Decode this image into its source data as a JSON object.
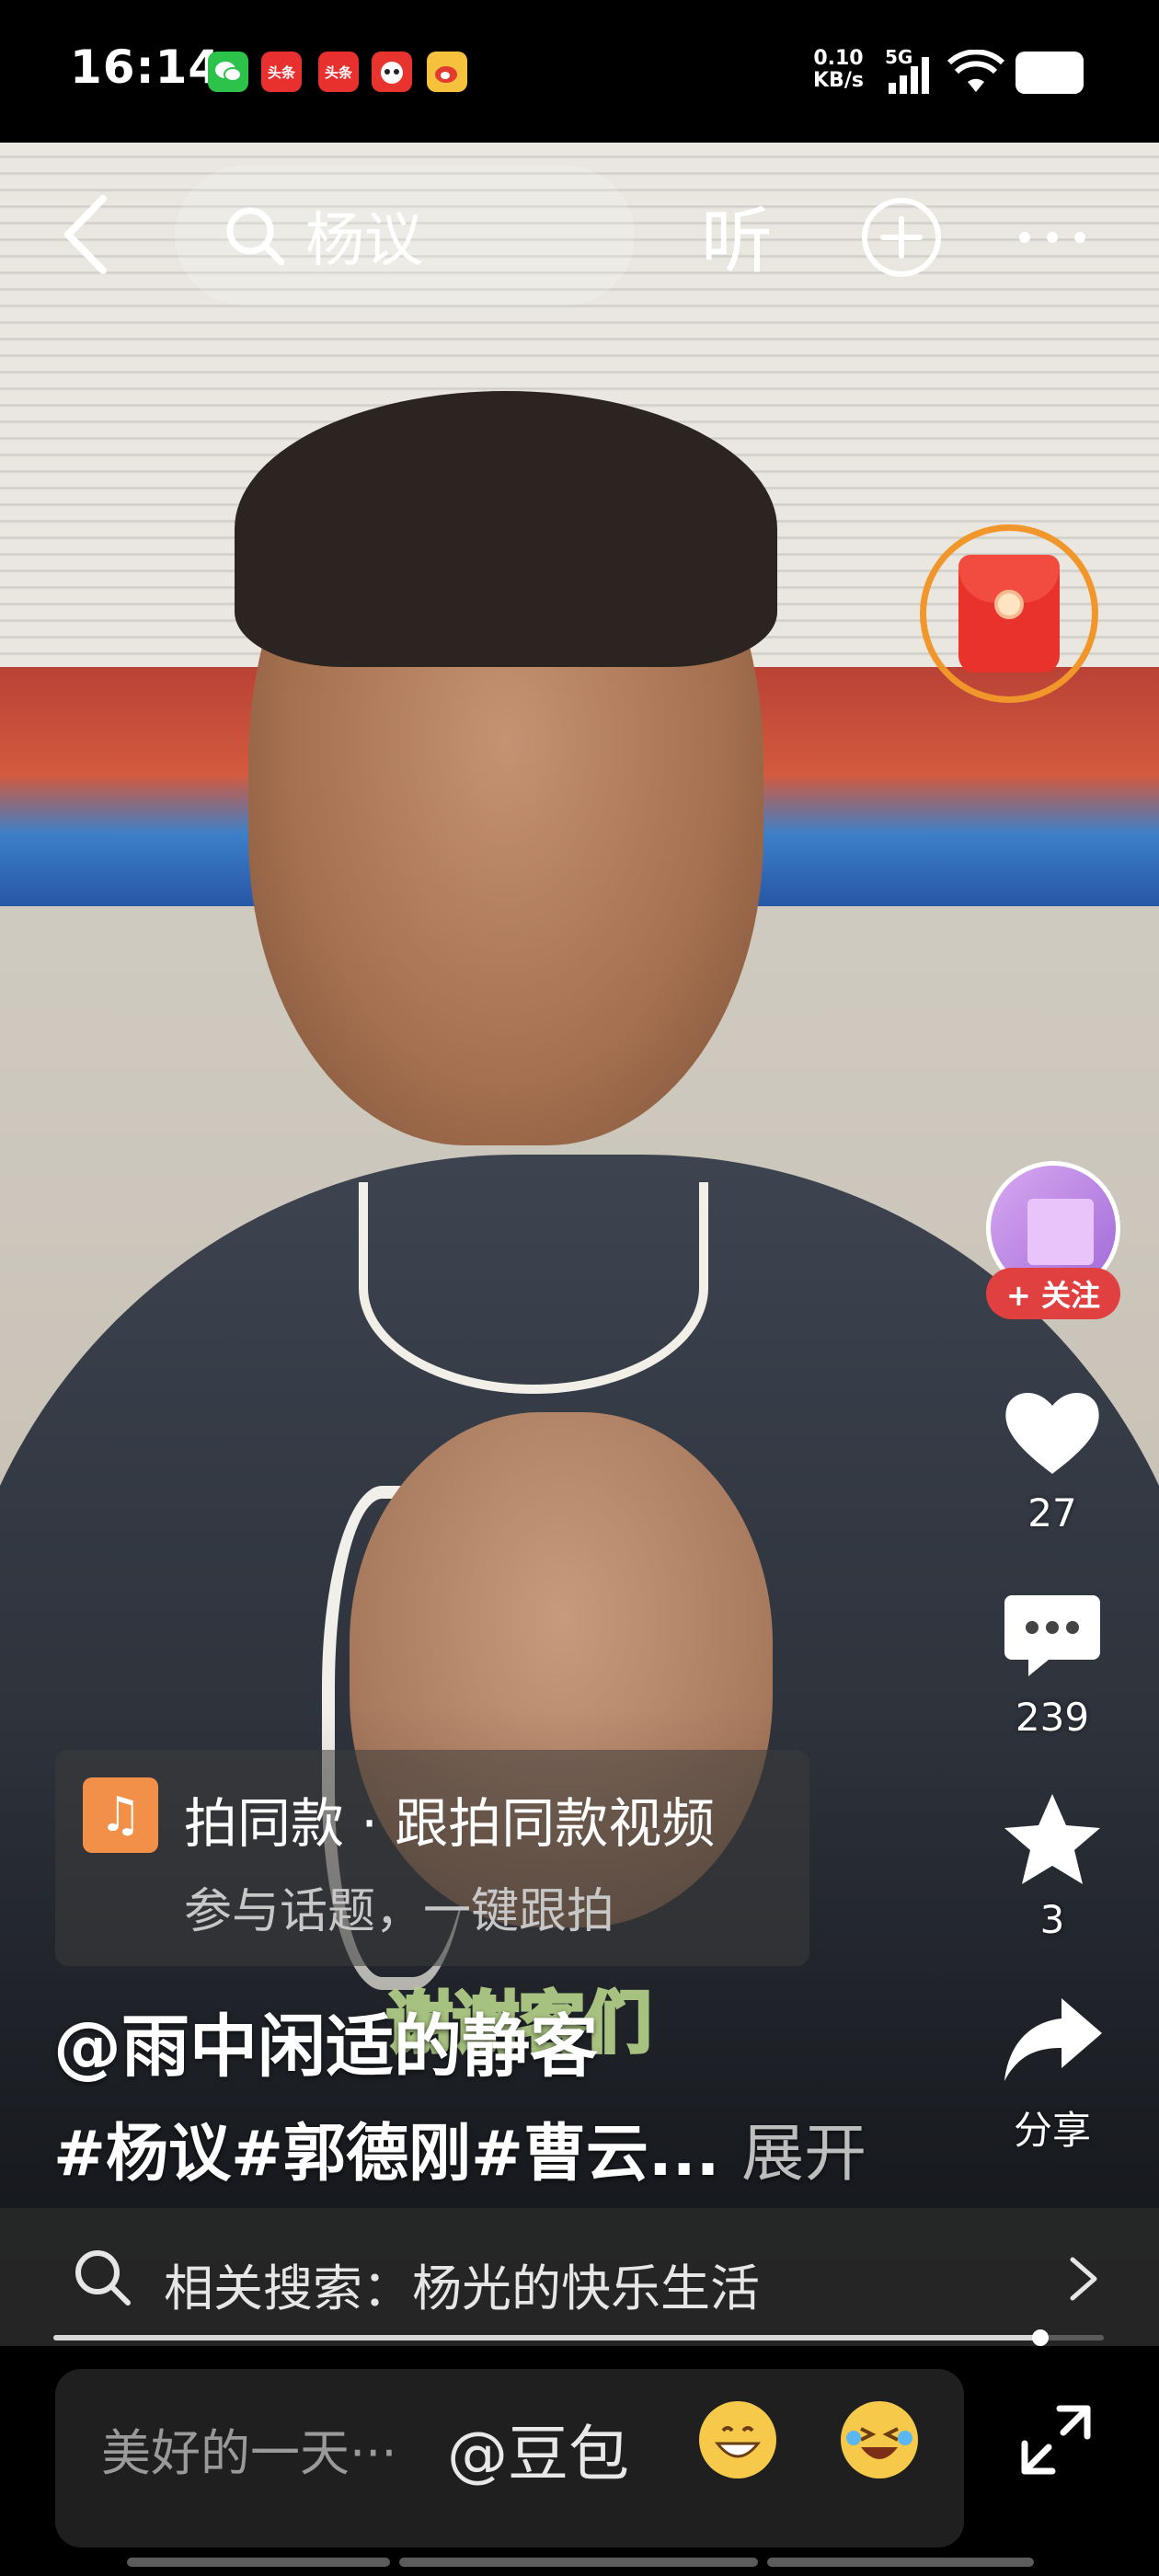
{
  "status_bar": {
    "time": "16:14",
    "app_icons": [
      "wechat-icon",
      "toutiao-icon",
      "toutiao-icon",
      "app-icon",
      "weibo-icon"
    ],
    "toutiao_label": "头条",
    "net_speed_value": "0.10",
    "net_speed_unit": "KB/s",
    "network": "5G"
  },
  "top_nav": {
    "search_query": "杨议",
    "listen_label": "听"
  },
  "right_actions": {
    "follow_label": "+ 关注",
    "likes": "27",
    "comments": "239",
    "favorites": "3",
    "share_label": "分享"
  },
  "template_banner": {
    "title": "拍同款 · 跟拍同款视频",
    "subtitle": "参与话题，一键跟拍"
  },
  "caption": {
    "overlay_subtitle": "谢谢客们",
    "author": "@雨中闲适的静客",
    "tags": "#杨议#郭德刚#曹云...",
    "expand_label": "展开"
  },
  "related_search": {
    "text": "相关搜索：杨光的快乐生活"
  },
  "playback": {
    "progress": 0.94
  },
  "comment_bar": {
    "placeholder": "美好的一天···",
    "mention": "@豆包"
  },
  "colors": {
    "accent_red": "#e0403f",
    "template_orange": "#f2904a",
    "packet_ring": "#f0962a"
  }
}
